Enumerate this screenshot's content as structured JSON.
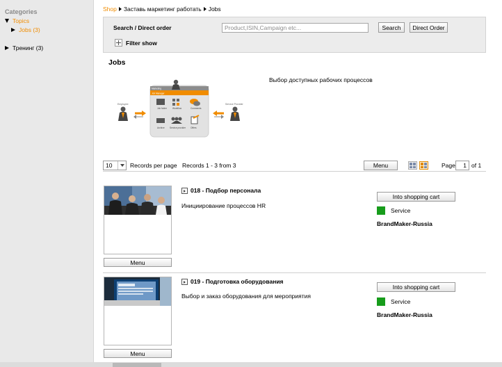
{
  "sidebar": {
    "title": "Categories",
    "topics_label": "Topics",
    "jobs_label": "Jobs (3)",
    "training_label": "Тренинг (3)"
  },
  "breadcrumb": {
    "shop": "Shop",
    "campaign": "Заставь маркетинг работать",
    "current": "Jobs"
  },
  "search": {
    "label": "Search / Direct order",
    "placeholder": "Product,ISIN,Campaign etc...",
    "search_button": "Search",
    "direct_order_button": "Direct Order",
    "filter_label": "Filter show"
  },
  "section": {
    "title": "Jobs",
    "description": "Выбор доступных рабочих процессов"
  },
  "diagram": {
    "marketing": "Marketing",
    "job_manager": "Job Manager",
    "employee": "Employee",
    "service_provider": "Service Provider",
    "items": [
      "Job folder",
      "Workflow & templates",
      "Comments & reviews",
      "Archive",
      "Service provider management",
      "Offers & orders"
    ]
  },
  "pager": {
    "per_page_value": "10",
    "per_page_label": "Records per page",
    "records_text": "Records 1 - 3 from 3",
    "menu_button": "Menu",
    "page_label": "Page",
    "page_value": "1",
    "page_total": "of 1"
  },
  "records": [
    {
      "title": "018 - Подбор персонала",
      "description": "Инициирование процессов HR",
      "cart_button": "Into shopping cart",
      "service_label": "Service",
      "provider": "BrandMaker-Russia",
      "menu_button": "Menu"
    },
    {
      "title": "019 - Подготовка оборудования",
      "description": "Выбор и заказ оборудования для мероприятия",
      "cart_button": "Into shopping cart",
      "service_label": "Service",
      "provider": "BrandMaker-Russia",
      "menu_button": "Menu"
    }
  ],
  "colors": {
    "accent": "#f08c00",
    "service_green": "#179c1b",
    "sidebar_bg": "#e9e9e9"
  }
}
